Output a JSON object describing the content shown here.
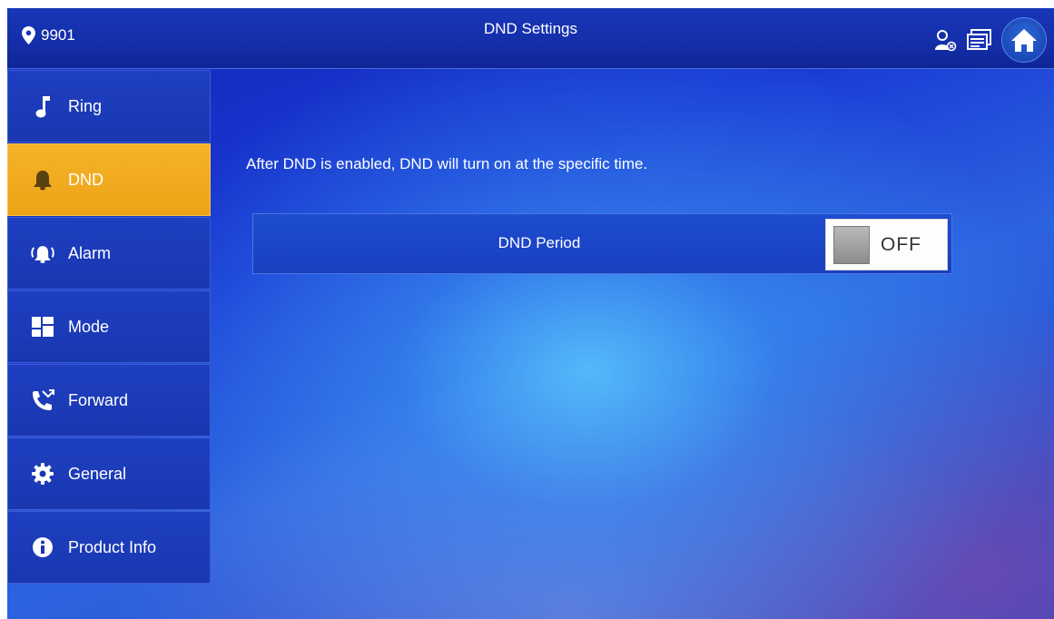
{
  "header": {
    "location_text": "9901",
    "title": "DND Settings",
    "icons": [
      "location-pin-icon",
      "monitor-user-icon",
      "message-icon",
      "home-icon"
    ]
  },
  "sidebar": {
    "items": [
      {
        "label": "Ring",
        "icon": "music-note-icon",
        "active": false
      },
      {
        "label": "DND",
        "icon": "bell-icon",
        "active": true
      },
      {
        "label": "Alarm",
        "icon": "alarm-icon",
        "active": false
      },
      {
        "label": "Mode",
        "icon": "grid-icon",
        "active": false
      },
      {
        "label": "Forward",
        "icon": "forward-call-icon",
        "active": false
      },
      {
        "label": "General",
        "icon": "gear-icon",
        "active": false
      },
      {
        "label": "Product Info",
        "icon": "info-icon",
        "active": false
      }
    ]
  },
  "main": {
    "description": "After DND is enabled, DND will turn on at the specific time.",
    "dnd_period": {
      "label": "DND Period",
      "state": "OFF"
    }
  },
  "colors": {
    "accent_active": "#f4b32a",
    "bar_blue": "#1736b8"
  }
}
